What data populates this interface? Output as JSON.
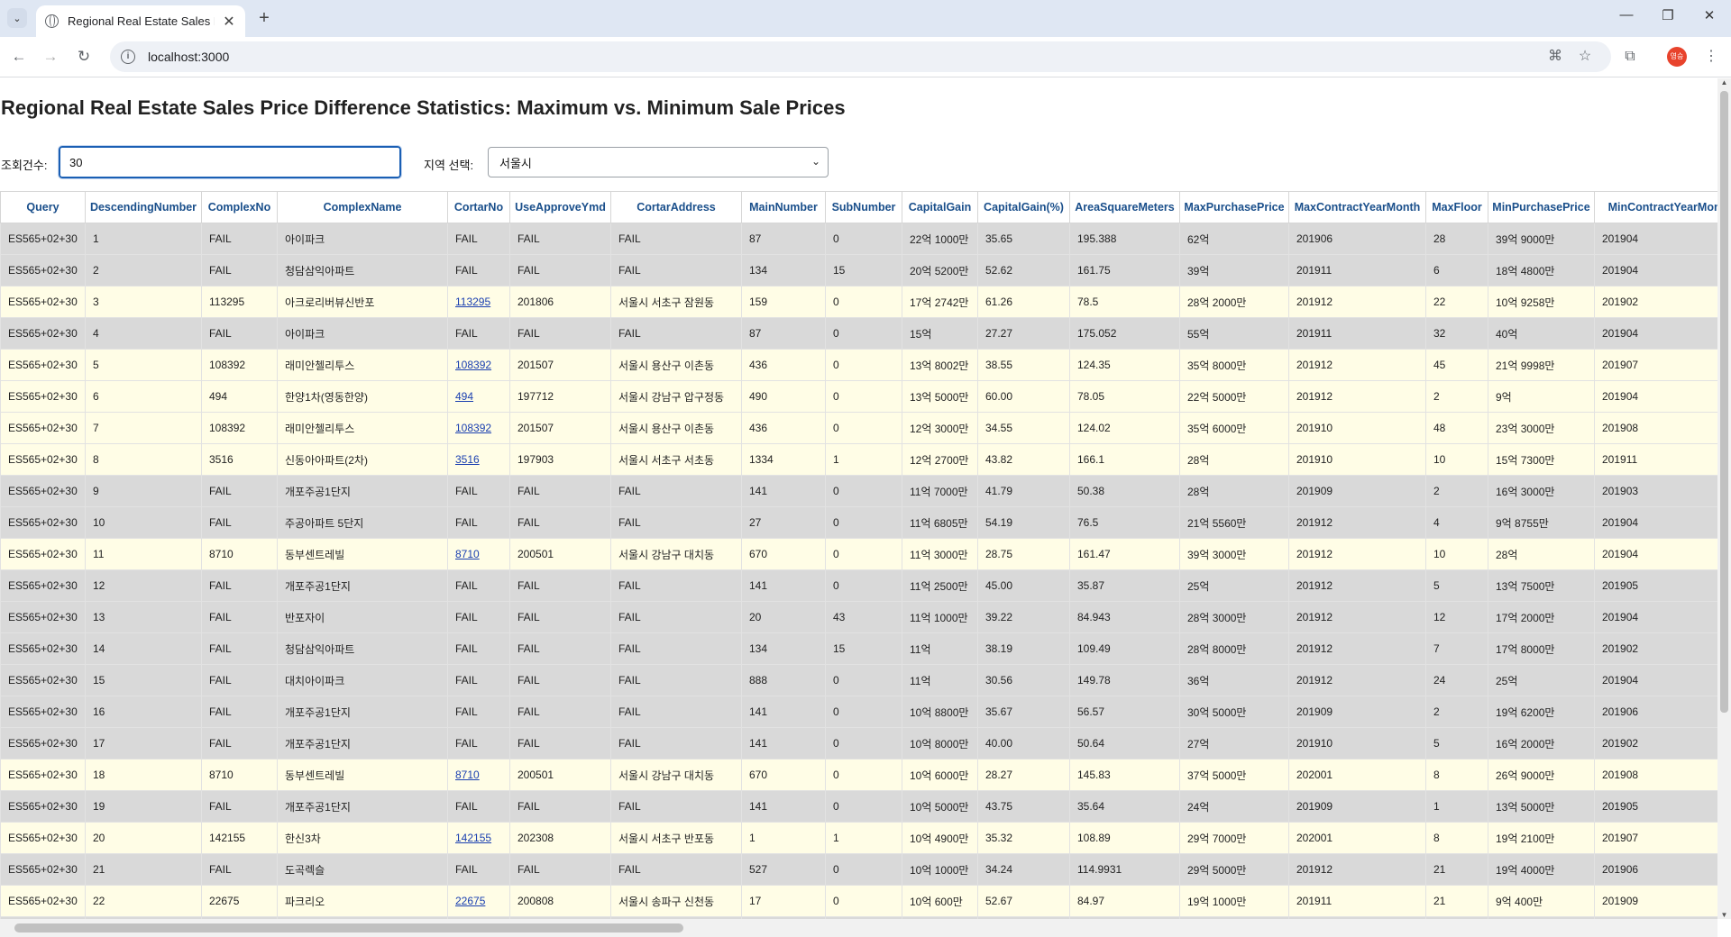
{
  "browser": {
    "tab_title": "Regional Real Estate Sales Pric",
    "url": "localhost:3000",
    "profile_text": "영승"
  },
  "page": {
    "title": "Regional Real Estate Sales Price Difference Statistics: Maximum vs. Minimum Sale Prices",
    "count_label": "조회건수:",
    "count_value": "30",
    "region_label": "지역 선택:",
    "region_value": "서울시"
  },
  "table": {
    "columns": [
      "Query",
      "DescendingNumber",
      "ComplexNo",
      "ComplexName",
      "CortarNo",
      "UseApproveYmd",
      "CortarAddress",
      "MainNumber",
      "SubNumber",
      "CapitalGain",
      "CapitalGain(%)",
      "AreaSquareMeters",
      "MaxPurchasePrice",
      "MaxContractYearMonth",
      "MaxFloor",
      "MinPurchasePrice",
      "MinContractYearMonth"
    ],
    "rows": [
      {
        "style": "gray",
        "link": false,
        "cells": [
          "ES565+02+30",
          "1",
          "FAIL",
          "아이파크",
          "FAIL",
          "FAIL",
          "FAIL",
          "87",
          "0",
          "22억 1000만",
          "35.65",
          "195.388",
          "62억",
          "201906",
          "28",
          "39억 9000만",
          "201904"
        ]
      },
      {
        "style": "gray",
        "link": false,
        "cells": [
          "ES565+02+30",
          "2",
          "FAIL",
          "청담삼익아파트",
          "FAIL",
          "FAIL",
          "FAIL",
          "134",
          "15",
          "20억 5200만",
          "52.62",
          "161.75",
          "39억",
          "201911",
          "6",
          "18억 4800만",
          "201904"
        ]
      },
      {
        "style": "cream",
        "link": true,
        "cells": [
          "ES565+02+30",
          "3",
          "113295",
          "아크로리버뷰신반포",
          "113295",
          "201806",
          "서울시 서초구 잠원동",
          "159",
          "0",
          "17억 2742만",
          "61.26",
          "78.5",
          "28억 2000만",
          "201912",
          "22",
          "10억 9258만",
          "201902"
        ]
      },
      {
        "style": "gray",
        "link": false,
        "cells": [
          "ES565+02+30",
          "4",
          "FAIL",
          "아이파크",
          "FAIL",
          "FAIL",
          "FAIL",
          "87",
          "0",
          "15억",
          "27.27",
          "175.052",
          "55억",
          "201911",
          "32",
          "40억",
          "201904"
        ]
      },
      {
        "style": "cream",
        "link": true,
        "cells": [
          "ES565+02+30",
          "5",
          "108392",
          "래미안첼리투스",
          "108392",
          "201507",
          "서울시 용산구 이촌동",
          "436",
          "0",
          "13억 8002만",
          "38.55",
          "124.35",
          "35억 8000만",
          "201912",
          "45",
          "21억 9998만",
          "201907"
        ]
      },
      {
        "style": "cream",
        "link": true,
        "cells": [
          "ES565+02+30",
          "6",
          "494",
          "한양1차(영동한양)",
          "494",
          "197712",
          "서울시 강남구 압구정동",
          "490",
          "0",
          "13억 5000만",
          "60.00",
          "78.05",
          "22억 5000만",
          "201912",
          "2",
          "9억",
          "201904"
        ]
      },
      {
        "style": "cream",
        "link": true,
        "cells": [
          "ES565+02+30",
          "7",
          "108392",
          "래미안첼리투스",
          "108392",
          "201507",
          "서울시 용산구 이촌동",
          "436",
          "0",
          "12억 3000만",
          "34.55",
          "124.02",
          "35억 6000만",
          "201910",
          "48",
          "23억 3000만",
          "201908"
        ]
      },
      {
        "style": "cream",
        "link": true,
        "cells": [
          "ES565+02+30",
          "8",
          "3516",
          "신동아아파트(2차)",
          "3516",
          "197903",
          "서울시 서초구 서초동",
          "1334",
          "1",
          "12억 2700만",
          "43.82",
          "166.1",
          "28억",
          "201910",
          "10",
          "15억 7300만",
          "201911"
        ]
      },
      {
        "style": "gray",
        "link": false,
        "cells": [
          "ES565+02+30",
          "9",
          "FAIL",
          "개포주공1단지",
          "FAIL",
          "FAIL",
          "FAIL",
          "141",
          "0",
          "11억 7000만",
          "41.79",
          "50.38",
          "28억",
          "201909",
          "2",
          "16억 3000만",
          "201903"
        ]
      },
      {
        "style": "gray",
        "link": false,
        "cells": [
          "ES565+02+30",
          "10",
          "FAIL",
          "주공아파트 5단지",
          "FAIL",
          "FAIL",
          "FAIL",
          "27",
          "0",
          "11억 6805만",
          "54.19",
          "76.5",
          "21억 5560만",
          "201912",
          "4",
          "9억 8755만",
          "201904"
        ]
      },
      {
        "style": "cream",
        "link": true,
        "cells": [
          "ES565+02+30",
          "11",
          "8710",
          "동부센트레빌",
          "8710",
          "200501",
          "서울시 강남구 대치동",
          "670",
          "0",
          "11억 3000만",
          "28.75",
          "161.47",
          "39억 3000만",
          "201912",
          "10",
          "28억",
          "201904"
        ]
      },
      {
        "style": "gray",
        "link": false,
        "cells": [
          "ES565+02+30",
          "12",
          "FAIL",
          "개포주공1단지",
          "FAIL",
          "FAIL",
          "FAIL",
          "141",
          "0",
          "11억 2500만",
          "45.00",
          "35.87",
          "25억",
          "201912",
          "5",
          "13억 7500만",
          "201905"
        ]
      },
      {
        "style": "gray",
        "link": false,
        "cells": [
          "ES565+02+30",
          "13",
          "FAIL",
          "반포자이",
          "FAIL",
          "FAIL",
          "FAIL",
          "20",
          "43",
          "11억 1000만",
          "39.22",
          "84.943",
          "28억 3000만",
          "201912",
          "12",
          "17억 2000만",
          "201904"
        ]
      },
      {
        "style": "gray",
        "link": false,
        "cells": [
          "ES565+02+30",
          "14",
          "FAIL",
          "청담삼익아파트",
          "FAIL",
          "FAIL",
          "FAIL",
          "134",
          "15",
          "11억",
          "38.19",
          "109.49",
          "28억 8000만",
          "201912",
          "7",
          "17억 8000만",
          "201902"
        ]
      },
      {
        "style": "gray",
        "link": false,
        "cells": [
          "ES565+02+30",
          "15",
          "FAIL",
          "대치아이파크",
          "FAIL",
          "FAIL",
          "FAIL",
          "888",
          "0",
          "11억",
          "30.56",
          "149.78",
          "36억",
          "201912",
          "24",
          "25억",
          "201904"
        ]
      },
      {
        "style": "gray",
        "link": false,
        "cells": [
          "ES565+02+30",
          "16",
          "FAIL",
          "개포주공1단지",
          "FAIL",
          "FAIL",
          "FAIL",
          "141",
          "0",
          "10억 8800만",
          "35.67",
          "56.57",
          "30억 5000만",
          "201909",
          "2",
          "19억 6200만",
          "201906"
        ]
      },
      {
        "style": "gray",
        "link": false,
        "cells": [
          "ES565+02+30",
          "17",
          "FAIL",
          "개포주공1단지",
          "FAIL",
          "FAIL",
          "FAIL",
          "141",
          "0",
          "10억 8000만",
          "40.00",
          "50.64",
          "27억",
          "201910",
          "5",
          "16억 2000만",
          "201902"
        ]
      },
      {
        "style": "cream",
        "link": true,
        "cells": [
          "ES565+02+30",
          "18",
          "8710",
          "동부센트레빌",
          "8710",
          "200501",
          "서울시 강남구 대치동",
          "670",
          "0",
          "10억 6000만",
          "28.27",
          "145.83",
          "37억 5000만",
          "202001",
          "8",
          "26억 9000만",
          "201908"
        ]
      },
      {
        "style": "gray",
        "link": false,
        "cells": [
          "ES565+02+30",
          "19",
          "FAIL",
          "개포주공1단지",
          "FAIL",
          "FAIL",
          "FAIL",
          "141",
          "0",
          "10억 5000만",
          "43.75",
          "35.64",
          "24억",
          "201909",
          "1",
          "13억 5000만",
          "201905"
        ]
      },
      {
        "style": "cream",
        "link": true,
        "cells": [
          "ES565+02+30",
          "20",
          "142155",
          "한신3차",
          "142155",
          "202308",
          "서울시 서초구 반포동",
          "1",
          "1",
          "10억 4900만",
          "35.32",
          "108.89",
          "29억 7000만",
          "202001",
          "8",
          "19억 2100만",
          "201907"
        ]
      },
      {
        "style": "gray",
        "link": false,
        "cells": [
          "ES565+02+30",
          "21",
          "FAIL",
          "도곡렉슬",
          "FAIL",
          "FAIL",
          "FAIL",
          "527",
          "0",
          "10억 1000만",
          "34.24",
          "114.9931",
          "29억 5000만",
          "201912",
          "21",
          "19억 4000만",
          "201906"
        ]
      },
      {
        "style": "cream",
        "link": true,
        "cells": [
          "ES565+02+30",
          "22",
          "22675",
          "파크리오",
          "22675",
          "200808",
          "서울시 송파구 신천동",
          "17",
          "0",
          "10억 600만",
          "52.67",
          "84.97",
          "19억 1000만",
          "201911",
          "21",
          "9억 400만",
          "201909"
        ]
      },
      {
        "style": "gray",
        "link": false,
        "cells": [
          "",
          "",
          "",
          "",
          "",
          "",
          "",
          "",
          "",
          "",
          "",
          "",
          "",
          "",
          "",
          "",
          ""
        ]
      }
    ]
  }
}
